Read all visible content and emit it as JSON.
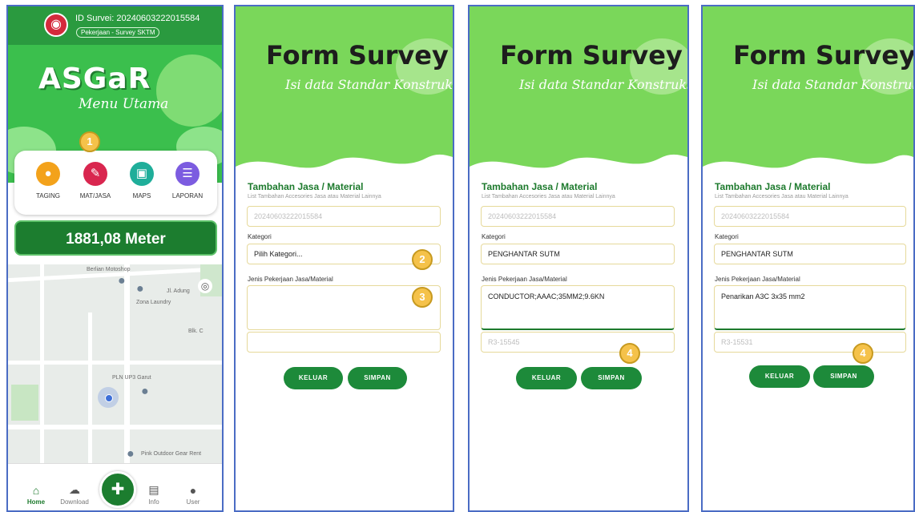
{
  "home": {
    "survey_id": "ID Survei: 20240603222015584",
    "job": "Pekerjaan - Survey SKTM",
    "brand": "ASGaR",
    "subtitle": "Menu Utama",
    "menu": [
      {
        "label": "TAGING",
        "icon": "pin-icon",
        "color": "#f3a21b"
      },
      {
        "label": "MAT/JASA",
        "icon": "note-add-icon",
        "color": "#d9264f"
      },
      {
        "label": "MAPS",
        "icon": "map-icon",
        "color": "#1fae9a"
      },
      {
        "label": "LAPORAN",
        "icon": "report-icon",
        "color": "#7c5ce0"
      }
    ],
    "distance": "1881,08 Meter",
    "map_labels": {
      "shop": "Berlian Motoshop",
      "road": "Jl. Adung",
      "laundry": "Zona Laundry",
      "block": "Blk. C",
      "pln": "PLN UP3 Garut",
      "gear": "Pink Outdoor Gear Rent"
    },
    "nav": [
      "Home",
      "Download",
      "Info",
      "User"
    ],
    "badge": "1"
  },
  "form": {
    "title": "Form Survey",
    "subtitle": "Isi data Standar Konstruksi",
    "section_title": "Tambahan Jasa / Material",
    "section_desc": "List Tambahan Accesories Jasa atau Material Lainnya",
    "id_value": "20240603222015584",
    "kategori_label": "Kategori",
    "jenis_label": "Jenis Pekerjaan Jasa/Material",
    "btn_keluar": "KELUAR",
    "btn_simpan": "SIMPAN"
  },
  "screen2": {
    "kategori_value": "Pilih Kategori...",
    "badge_a": "2",
    "badge_b": "3"
  },
  "screen3": {
    "kategori_value": "PENGHANTAR SUTM",
    "jenis_value": "CONDUCTOR;AAAC;35MM2;9.6KN",
    "code_value": "R3-15545",
    "badge": "4"
  },
  "screen4": {
    "kategori_value": "PENGHANTAR SUTM",
    "jenis_value": "Penarikan A3C 3x35 mm2",
    "code_value": "R3-15531",
    "badge": "4"
  }
}
